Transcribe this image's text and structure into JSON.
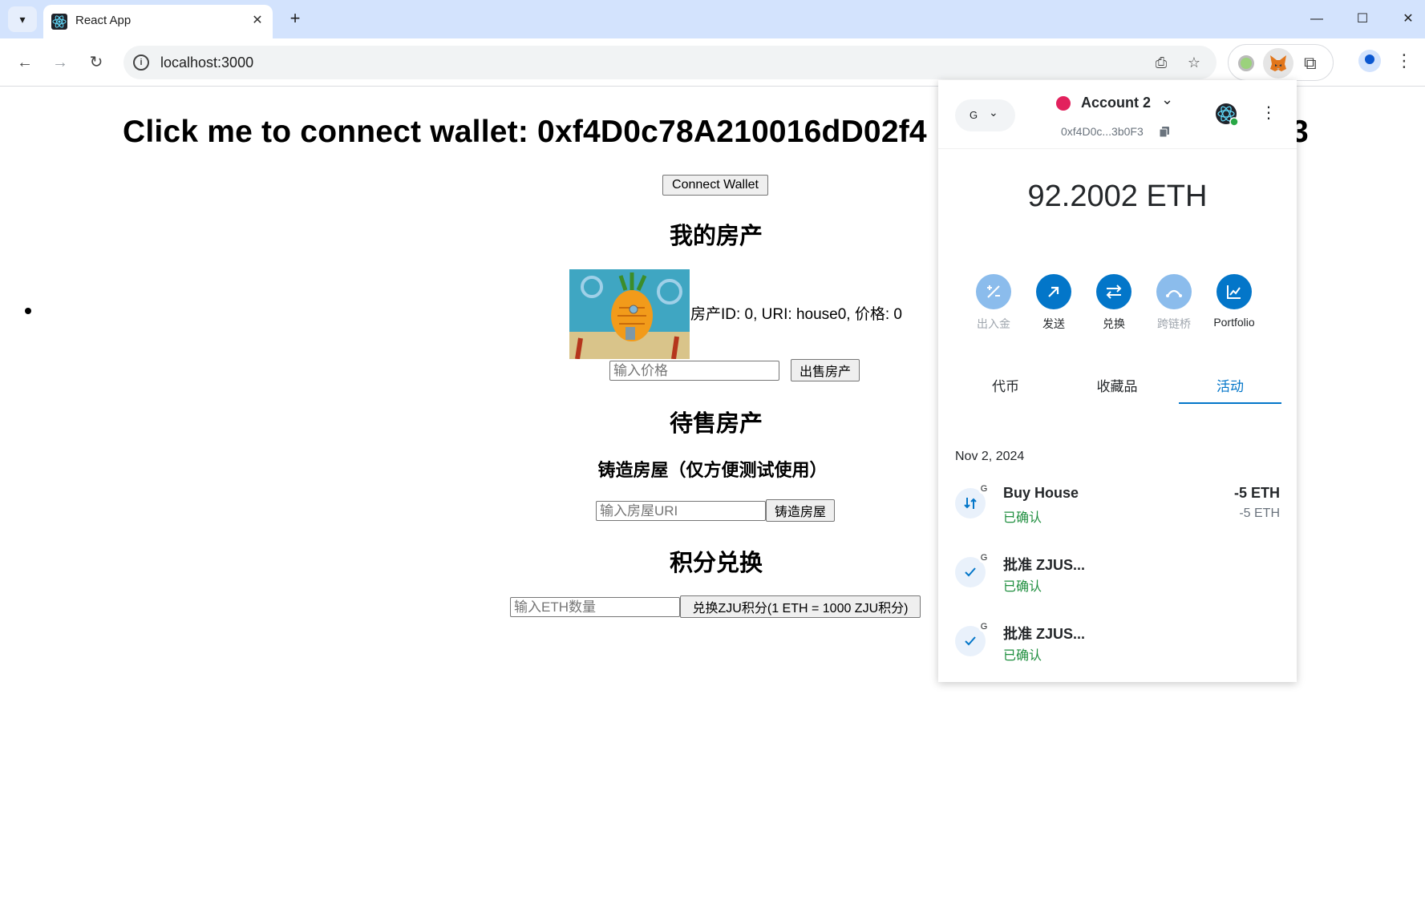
{
  "browser": {
    "tab_title": "React App",
    "url": "localhost:3000"
  },
  "page": {
    "title": "Click me to connect wallet: 0xf4D0c78A210016dD02f4",
    "title_tail": "3",
    "connect_button": "Connect Wallet",
    "my_houses_heading": "我的房产",
    "house_item": "房产ID: 0, URI: house0, 价格: 0",
    "price_input_placeholder": "输入价格",
    "sell_button": "出售房产",
    "for_sale_heading": "待售房产",
    "mint_heading": "铸造房屋（仅方便测试使用）",
    "uri_input_placeholder": "输入房屋URI",
    "mint_button": "铸造房屋",
    "exchange_heading": "积分兑换",
    "eth_input_placeholder": "输入ETH数量",
    "exchange_button": "兑换ZJU积分(1 ETH = 1000 ZJU积分)"
  },
  "metamask": {
    "network_label": "G",
    "account_name": "Account 2",
    "account_address": "0xf4D0c...3b0F3",
    "balance": "92.2002 ETH",
    "actions": [
      {
        "label": "出入金",
        "icon": "plus-minus-icon",
        "enabled": false
      },
      {
        "label": "发送",
        "icon": "arrow-up-right-icon",
        "enabled": true
      },
      {
        "label": "兑换",
        "icon": "swap-icon",
        "enabled": true
      },
      {
        "label": "跨链桥",
        "icon": "bridge-icon",
        "enabled": false
      },
      {
        "label": "Portfolio",
        "icon": "chart-icon",
        "enabled": true
      }
    ],
    "tabs": [
      "代币",
      "收藏品",
      "活动"
    ],
    "active_tab": "活动",
    "date": "Nov 2, 2024",
    "transactions": [
      {
        "title": "Buy House",
        "status": "已确认",
        "amount": "-5 ETH",
        "amount_secondary": "-5 ETH",
        "icon": "contract-interaction-icon",
        "badge": "G"
      },
      {
        "title": "批准 ZJUS...",
        "status": "已确认",
        "amount": "",
        "amount_secondary": "",
        "icon": "check-icon",
        "badge": "G"
      },
      {
        "title": "批准 ZJUS...",
        "status": "已确认",
        "amount": "",
        "amount_secondary": "",
        "icon": "check-icon",
        "badge": "G"
      }
    ]
  },
  "colors": {
    "tabbar": "#d3e3fd",
    "metamask_blue": "#0376c9",
    "confirmed_green": "#1e8e3e",
    "account_dot": "#e2215d"
  }
}
